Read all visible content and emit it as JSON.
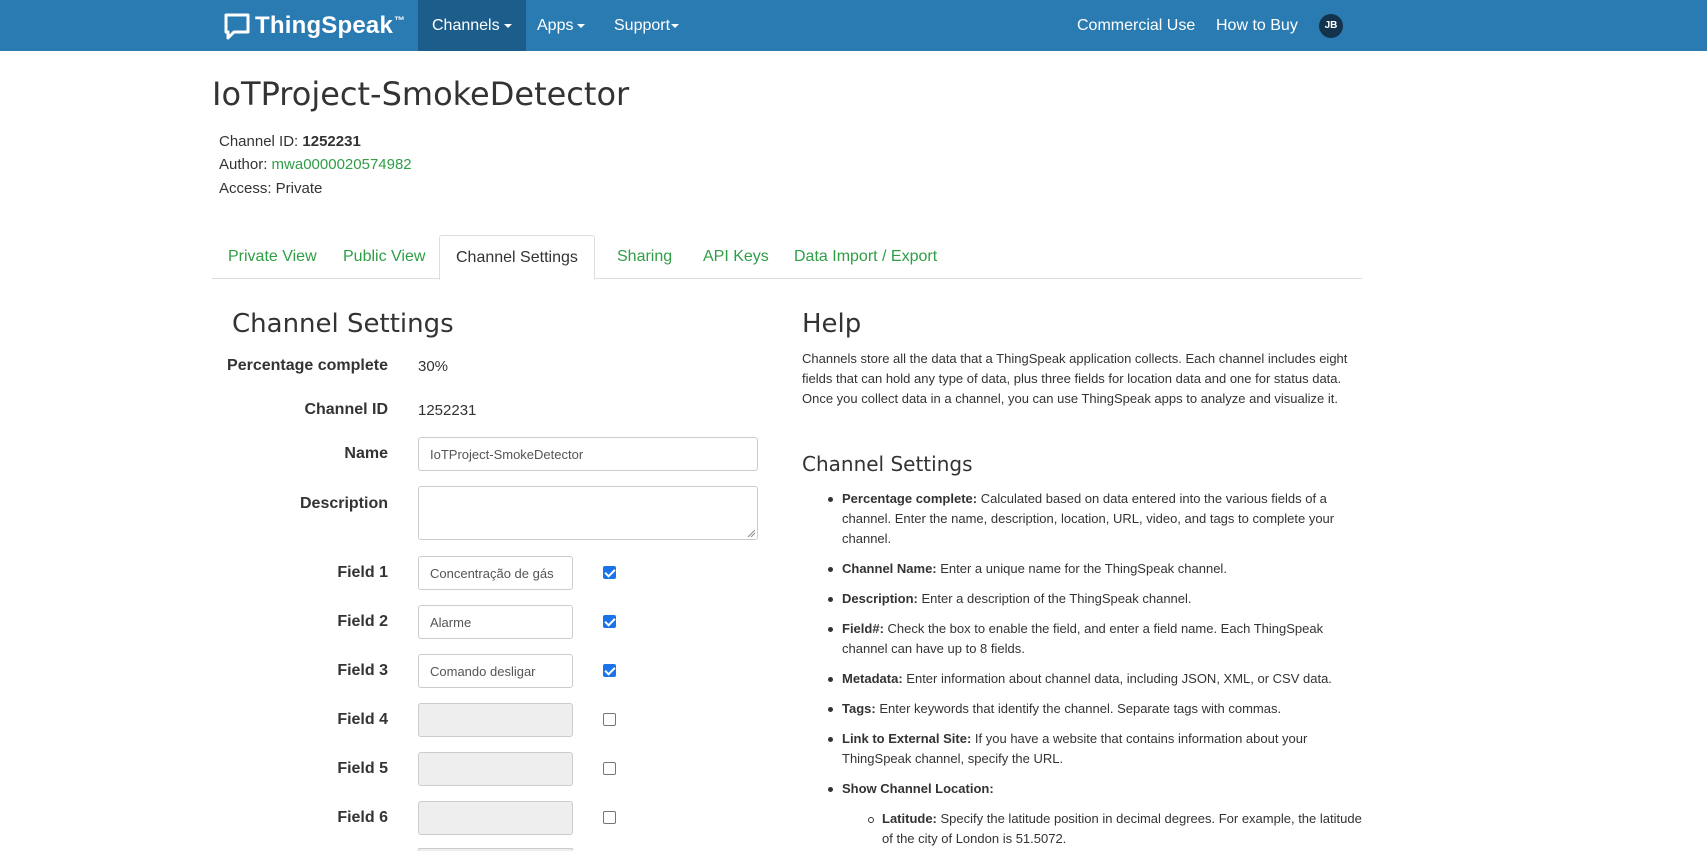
{
  "nav": {
    "brand": "ThingSpeak",
    "brand_tm": "™",
    "channels": "Channels",
    "apps": "Apps",
    "support": "Support",
    "commercial": "Commercial Use",
    "how_to_buy": "How to Buy",
    "avatar_initials": "JB"
  },
  "header": {
    "title": "IoTProject-SmokeDetector",
    "channel_id_label": "Channel ID: ",
    "channel_id": "1252231",
    "author_label": "Author: ",
    "author": "mwa0000020574982",
    "access": "Access: Private"
  },
  "tabs": [
    {
      "label": "Private View"
    },
    {
      "label": "Public View"
    },
    {
      "label": "Channel Settings"
    },
    {
      "label": "Sharing"
    },
    {
      "label": "API Keys"
    },
    {
      "label": "Data Import / Export"
    }
  ],
  "form": {
    "title": "Channel Settings",
    "percentage_label": "Percentage complete",
    "percentage_value": "30%",
    "channel_id_label": "Channel ID",
    "channel_id_value": "1252231",
    "name_label": "Name",
    "name_value": "IoTProject-SmokeDetector",
    "description_label": "Description",
    "fields": [
      {
        "label": "Field 1",
        "value": "Concentração de gás",
        "checked": true
      },
      {
        "label": "Field 2",
        "value": "Alarme",
        "checked": true
      },
      {
        "label": "Field 3",
        "value": "Comando desligar",
        "checked": true
      },
      {
        "label": "Field 4",
        "value": "",
        "checked": false
      },
      {
        "label": "Field 5",
        "value": "",
        "checked": false
      },
      {
        "label": "Field 6",
        "value": "",
        "checked": false
      }
    ]
  },
  "help": {
    "title": "Help",
    "intro": "Channels store all the data that a ThingSpeak application collects. Each channel includes eight fields that can hold any type of data, plus three fields for location data and one for status data. Once you collect data in a channel, you can use ThingSpeak apps to analyze and visualize it.",
    "settings_title": "Channel Settings",
    "items": [
      {
        "term": "Percentage complete:",
        "text": " Calculated based on data entered into the various fields of a channel. Enter the name, description, location, URL, video, and tags to complete your channel."
      },
      {
        "term": "Channel Name:",
        "text": " Enter a unique name for the ThingSpeak channel."
      },
      {
        "term": "Description:",
        "text": " Enter a description of the ThingSpeak channel."
      },
      {
        "term": "Field#:",
        "text": " Check the box to enable the field, and enter a field name. Each ThingSpeak channel can have up to 8 fields."
      },
      {
        "term": "Metadata:",
        "text": " Enter information about channel data, including JSON, XML, or CSV data."
      },
      {
        "term": "Tags:",
        "text": " Enter keywords that identify the channel. Separate tags with commas."
      },
      {
        "term": "Link to External Site:",
        "text": " If you have a website that contains information about your ThingSpeak channel, specify the URL."
      },
      {
        "term": "Show Channel Location:",
        "text": ""
      }
    ],
    "sub_items": [
      {
        "term": "Latitude:",
        "text": " Specify the latitude position in decimal degrees. For example, the latitude of the city of London is 51.5072."
      }
    ]
  }
}
